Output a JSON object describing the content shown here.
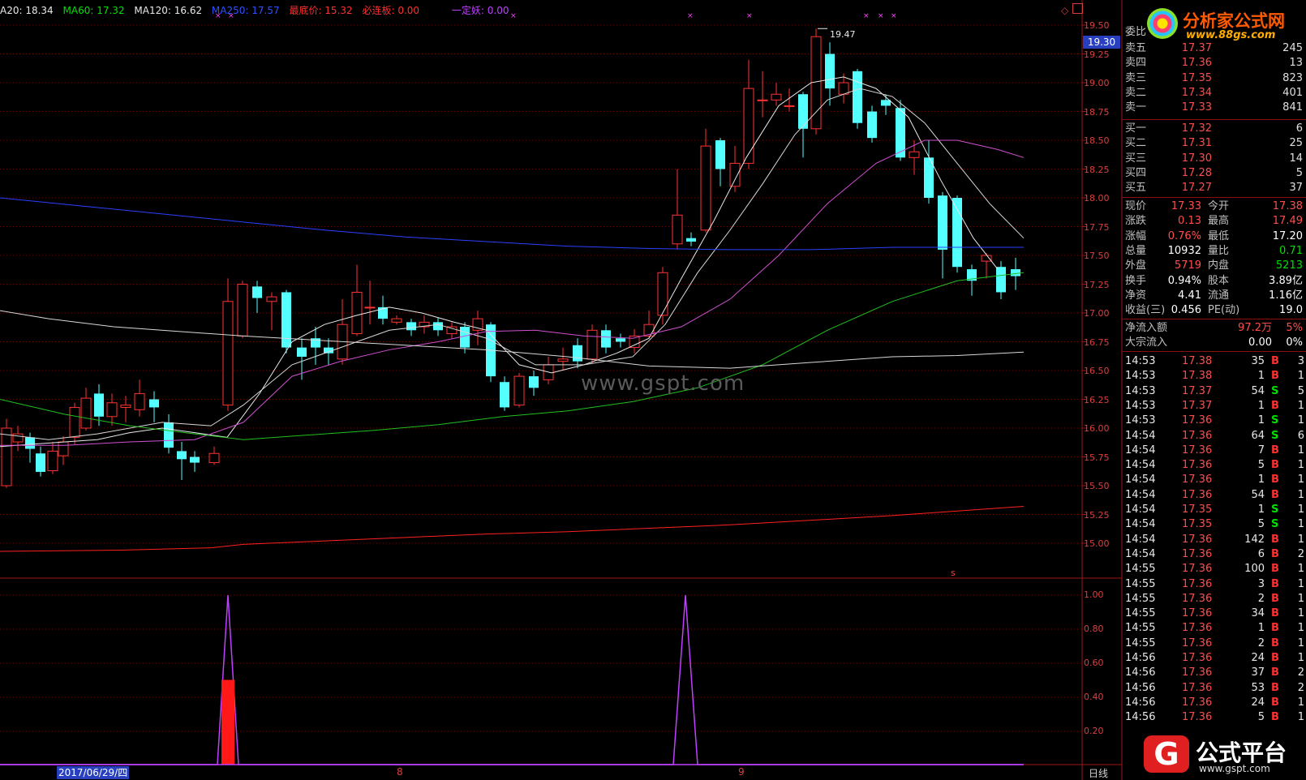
{
  "header": {
    "items": [
      {
        "label": "A20: 18.34",
        "color": "#e8e8e8"
      },
      {
        "label": "MA60: 17.32",
        "color": "#00e000"
      },
      {
        "label": "MA120: 16.62",
        "color": "#e8e8e8"
      },
      {
        "label": "MA250: 17.57",
        "color": "#3050ff"
      },
      {
        "label": "最底价: 15.32",
        "color": "#ff3030"
      },
      {
        "label": "必连板: 0.00",
        "color": "#ff3030"
      },
      {
        "label": "一定妖: 0.00",
        "color": "#c040ff"
      }
    ]
  },
  "price_axis": {
    "labels": [
      "19.50",
      "19.25",
      "19.00",
      "18.75",
      "18.50",
      "18.25",
      "18.00",
      "17.75",
      "17.50",
      "17.25",
      "17.00",
      "16.75",
      "16.50",
      "16.25",
      "16.00",
      "15.75",
      "15.50",
      "15.25",
      "15.00"
    ],
    "current": "19.30",
    "high_marker": "19.47"
  },
  "indicator_axis": {
    "labels": [
      "1.00",
      "0.80",
      "0.60",
      "0.40",
      "0.20"
    ]
  },
  "date_axis": {
    "selected_date": "2017/06/29/四",
    "month_labels": [
      "8",
      "9"
    ],
    "period": "日线"
  },
  "watermarks": {
    "center": "www.gspt.com",
    "top_logo": "分析家公式网",
    "top_logo_url": "www.88gs.com",
    "bottom_logo": "公式平台",
    "bottom_logo_badge": "G",
    "bottom_logo_url": "www.gspt.com"
  },
  "quote_panel": {
    "title": "委比",
    "asks": [
      {
        "label": "卖五",
        "price": "17.37",
        "vol": "245"
      },
      {
        "label": "卖四",
        "price": "17.36",
        "vol": "13"
      },
      {
        "label": "卖三",
        "price": "17.35",
        "vol": "823"
      },
      {
        "label": "卖二",
        "price": "17.34",
        "vol": "401"
      },
      {
        "label": "卖一",
        "price": "17.33",
        "vol": "841"
      }
    ],
    "bids": [
      {
        "label": "买一",
        "price": "17.32",
        "vol": "6"
      },
      {
        "label": "买二",
        "price": "17.31",
        "vol": "25"
      },
      {
        "label": "买三",
        "price": "17.30",
        "vol": "14"
      },
      {
        "label": "买四",
        "price": "17.28",
        "vol": "5"
      },
      {
        "label": "买五",
        "price": "17.27",
        "vol": "37"
      }
    ],
    "stats": [
      {
        "k1": "现价",
        "v1": "17.33",
        "c1": "red",
        "k2": "今开",
        "v2": "17.38",
        "c2": "red"
      },
      {
        "k1": "涨跌",
        "v1": "0.13",
        "c1": "red",
        "k2": "最高",
        "v2": "17.49",
        "c2": "red"
      },
      {
        "k1": "涨幅",
        "v1": "0.76%",
        "c1": "red",
        "k2": "最低",
        "v2": "17.20",
        "c2": "white"
      },
      {
        "k1": "总量",
        "v1": "10932",
        "c1": "white",
        "k2": "量比",
        "v2": "0.71",
        "c2": "green"
      },
      {
        "k1": "外盘",
        "v1": "5719",
        "c1": "red",
        "k2": "内盘",
        "v2": "5213",
        "c2": "green"
      },
      {
        "k1": "换手",
        "v1": "0.94%",
        "c1": "white",
        "k2": "股本",
        "v2": "3.89亿",
        "c2": "white"
      },
      {
        "k1": "净资",
        "v1": "4.41",
        "c1": "white",
        "k2": "流通",
        "v2": "1.16亿",
        "c2": "white"
      },
      {
        "k1": "收益(三)",
        "v1": "0.456",
        "c1": "white",
        "k2": "PE(动)",
        "v2": "19.0",
        "c2": "white"
      }
    ],
    "flows": [
      {
        "label": "净流入额",
        "value": "97.2万",
        "pct": "5%",
        "color": "red"
      },
      {
        "label": "大宗流入",
        "value": "0.00",
        "pct": "0%",
        "color": "white"
      }
    ],
    "ticks": [
      {
        "t": "14:53",
        "p": "17.38",
        "v": "35",
        "d": "B",
        "n": "3"
      },
      {
        "t": "14:53",
        "p": "17.38",
        "v": "1",
        "d": "B",
        "n": "1"
      },
      {
        "t": "14:53",
        "p": "17.37",
        "v": "54",
        "d": "S",
        "n": "5"
      },
      {
        "t": "14:53",
        "p": "17.37",
        "v": "1",
        "d": "B",
        "n": "1"
      },
      {
        "t": "14:53",
        "p": "17.36",
        "v": "1",
        "d": "S",
        "n": "1"
      },
      {
        "t": "14:54",
        "p": "17.36",
        "v": "64",
        "d": "S",
        "n": "6"
      },
      {
        "t": "14:54",
        "p": "17.36",
        "v": "7",
        "d": "B",
        "n": "1"
      },
      {
        "t": "14:54",
        "p": "17.36",
        "v": "5",
        "d": "B",
        "n": "1"
      },
      {
        "t": "14:54",
        "p": "17.36",
        "v": "1",
        "d": "B",
        "n": "1"
      },
      {
        "t": "14:54",
        "p": "17.36",
        "v": "54",
        "d": "B",
        "n": "1"
      },
      {
        "t": "14:54",
        "p": "17.35",
        "v": "1",
        "d": "S",
        "n": "1"
      },
      {
        "t": "14:54",
        "p": "17.35",
        "v": "5",
        "d": "S",
        "n": "1"
      },
      {
        "t": "14:54",
        "p": "17.36",
        "v": "142",
        "d": "B",
        "n": "1"
      },
      {
        "t": "14:54",
        "p": "17.36",
        "v": "6",
        "d": "B",
        "n": "2"
      },
      {
        "t": "14:55",
        "p": "17.36",
        "v": "100",
        "d": "B",
        "n": "1"
      },
      {
        "t": "14:55",
        "p": "17.36",
        "v": "3",
        "d": "B",
        "n": "1"
      },
      {
        "t": "14:55",
        "p": "17.36",
        "v": "2",
        "d": "B",
        "n": "1"
      },
      {
        "t": "14:55",
        "p": "17.36",
        "v": "34",
        "d": "B",
        "n": "1"
      },
      {
        "t": "14:55",
        "p": "17.36",
        "v": "1",
        "d": "B",
        "n": "1"
      },
      {
        "t": "14:55",
        "p": "17.36",
        "v": "2",
        "d": "B",
        "n": "1"
      },
      {
        "t": "14:56",
        "p": "17.36",
        "v": "24",
        "d": "B",
        "n": "1"
      },
      {
        "t": "14:56",
        "p": "17.36",
        "v": "37",
        "d": "B",
        "n": "2"
      },
      {
        "t": "14:56",
        "p": "17.36",
        "v": "53",
        "d": "B",
        "n": "2"
      },
      {
        "t": "14:56",
        "p": "17.36",
        "v": "24",
        "d": "B",
        "n": "1"
      },
      {
        "t": "14:56",
        "p": "17.36",
        "v": "5",
        "d": "B",
        "n": "1"
      }
    ]
  },
  "colors": {
    "up": "#ff3232",
    "down": "#54ffff",
    "grid": "#6a0a0a",
    "axis": "#a01818"
  }
}
